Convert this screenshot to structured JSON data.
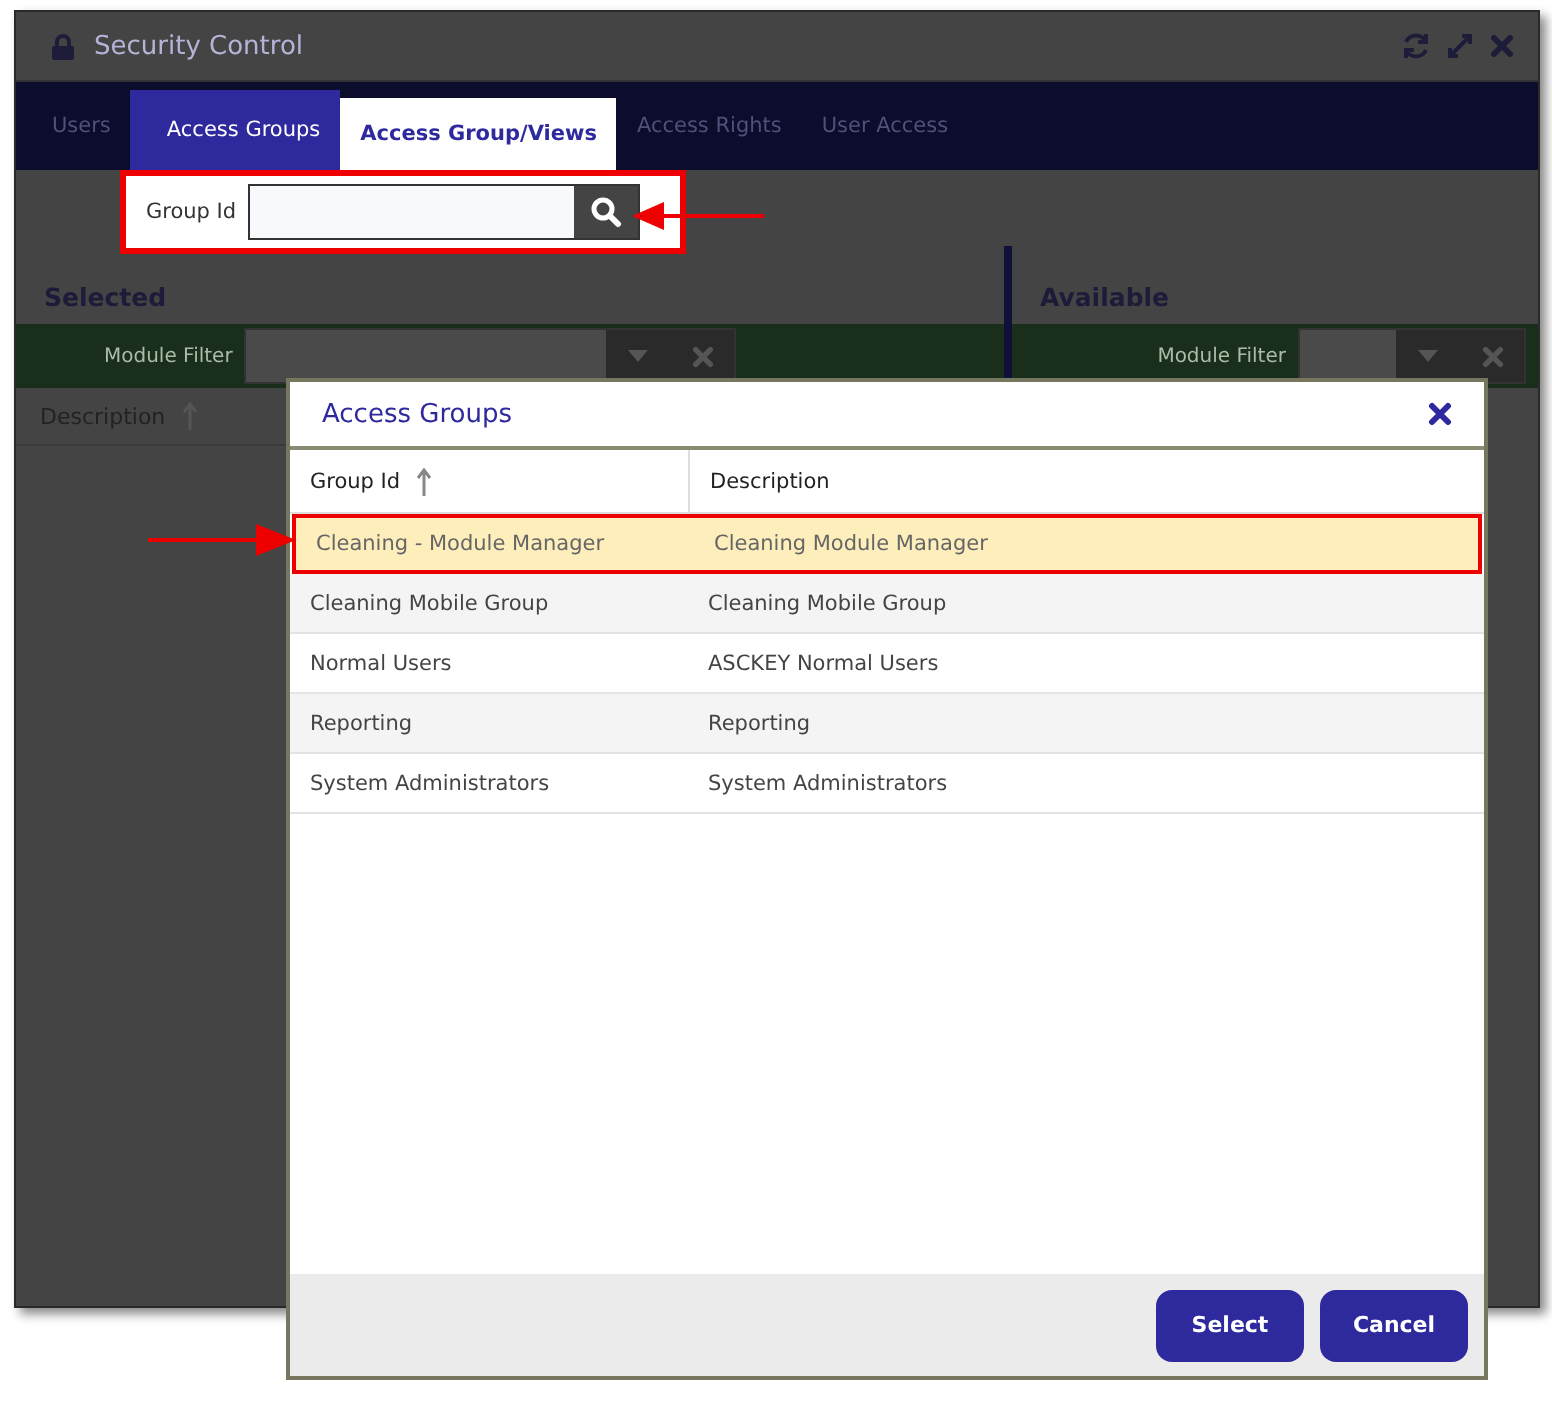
{
  "window": {
    "title": "Security Control"
  },
  "tabs": [
    {
      "label": "Users",
      "selected": false,
      "highlighted": false
    },
    {
      "label": "Access Groups",
      "selected": false,
      "highlighted": true
    },
    {
      "label": "Access Group/Views",
      "selected": true,
      "highlighted": true
    },
    {
      "label": "Access Rights",
      "selected": false,
      "highlighted": false
    },
    {
      "label": "User Access",
      "selected": false,
      "highlighted": false
    }
  ],
  "search": {
    "label": "Group Id"
  },
  "selected_panel": {
    "title": "Selected",
    "filter_label": "Module Filter",
    "column": "Description"
  },
  "available_panel": {
    "title": "Available",
    "filter_label": "Module Filter"
  },
  "dialog": {
    "title": "Access Groups",
    "columns": [
      "Group Id",
      "Description"
    ],
    "rows": [
      {
        "group_id": "Cleaning - Module Manager",
        "description": "Cleaning Module Manager",
        "selected": true
      },
      {
        "group_id": "Cleaning Mobile Group",
        "description": "Cleaning Mobile Group",
        "selected": false
      },
      {
        "group_id": "Normal Users",
        "description": "ASCKEY Normal Users",
        "selected": false
      },
      {
        "group_id": "Reporting",
        "description": "Reporting",
        "selected": false
      },
      {
        "group_id": "System Administrators",
        "description": "System Administrators",
        "selected": false
      }
    ],
    "buttons": [
      "Select",
      "Cancel"
    ]
  }
}
